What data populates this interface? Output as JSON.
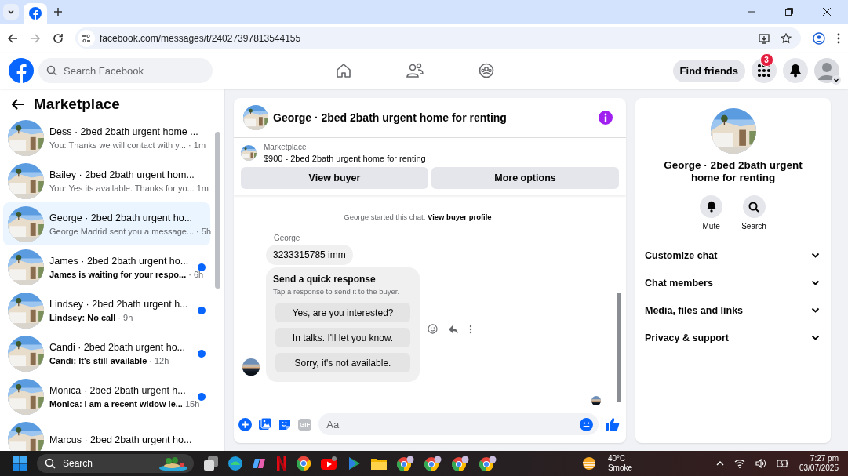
{
  "browser": {
    "url": "facebook.com/messages/t/24027397813544155",
    "forward_disabled": true
  },
  "header": {
    "search_placeholder": "Search Facebook",
    "find_friends": "Find friends",
    "notification_count": "3"
  },
  "sidebar": {
    "title": "Marketplace",
    "conversations": [
      {
        "title": "Dess · 2bed 2bath urgent home ...",
        "preview": "You: Thanks we will contact with y...",
        "time": "· 1m",
        "unread": false,
        "selected": false
      },
      {
        "title": "Bailey · 2bed 2bath urgent hom...",
        "preview": "You: Yes its available. Thanks for yo...",
        "time": "1m",
        "unread": false,
        "selected": false
      },
      {
        "title": "George · 2bed 2bath urgent ho...",
        "preview": "George Madrid sent you a message...",
        "time": "· 5h",
        "unread": false,
        "selected": true
      },
      {
        "title": "James · 2bed 2bath urgent ho...",
        "preview": "James is waiting for your respo...",
        "time": "· 6h",
        "unread": true,
        "selected": false
      },
      {
        "title": "Lindsey · 2bed 2bath urgent h...",
        "preview": "Lindsey: No call",
        "time": "· 9h",
        "unread": true,
        "selected": false
      },
      {
        "title": "Candi · 2bed 2bath urgent ho...",
        "preview": "Candi: It's still available",
        "time": "· 12h",
        "unread": true,
        "selected": false
      },
      {
        "title": "Monica · 2bed 2bath urgent h...",
        "preview": "Monica: I am a recent widow le...",
        "time": "15h",
        "unread": true,
        "selected": false
      },
      {
        "title": "Marcus · 2bed 2bath urgent ho..."
      }
    ]
  },
  "chat": {
    "title": "George · 2bed 2bath urgent home for renting",
    "listing_label": "Marketplace",
    "listing": "$900 - 2bed 2bath urgent home for renting",
    "buttons": [
      "View buyer",
      "More options"
    ],
    "notice": "George started this chat.",
    "notice_link": "View buyer profile",
    "sender": "George",
    "message": "3233315785 imm",
    "quick": {
      "title": "Send a quick response",
      "subtitle": "Tap a response to send it to the buyer.",
      "options": [
        "Yes, are you interested?",
        "In talks. I'll let you know.",
        "Sorry, it's not available."
      ]
    },
    "gif_label": "GIF",
    "composer_placeholder": "Aa"
  },
  "details": {
    "title": "George · 2bed 2bath urgent home for renting",
    "actions": [
      "Mute",
      "Search"
    ],
    "sections": [
      {
        "label": "Customize chat",
        "expanded": false
      },
      {
        "label": "Chat members",
        "expanded": false
      },
      {
        "label": "Media, files and links",
        "expanded": false
      },
      {
        "label": "Privacy & support",
        "expanded": false
      }
    ]
  },
  "taskbar": {
    "search": "Search",
    "temperature": "40°C",
    "weather": "Smoke",
    "time": "7:27 pm",
    "date": "03/07/2025"
  }
}
